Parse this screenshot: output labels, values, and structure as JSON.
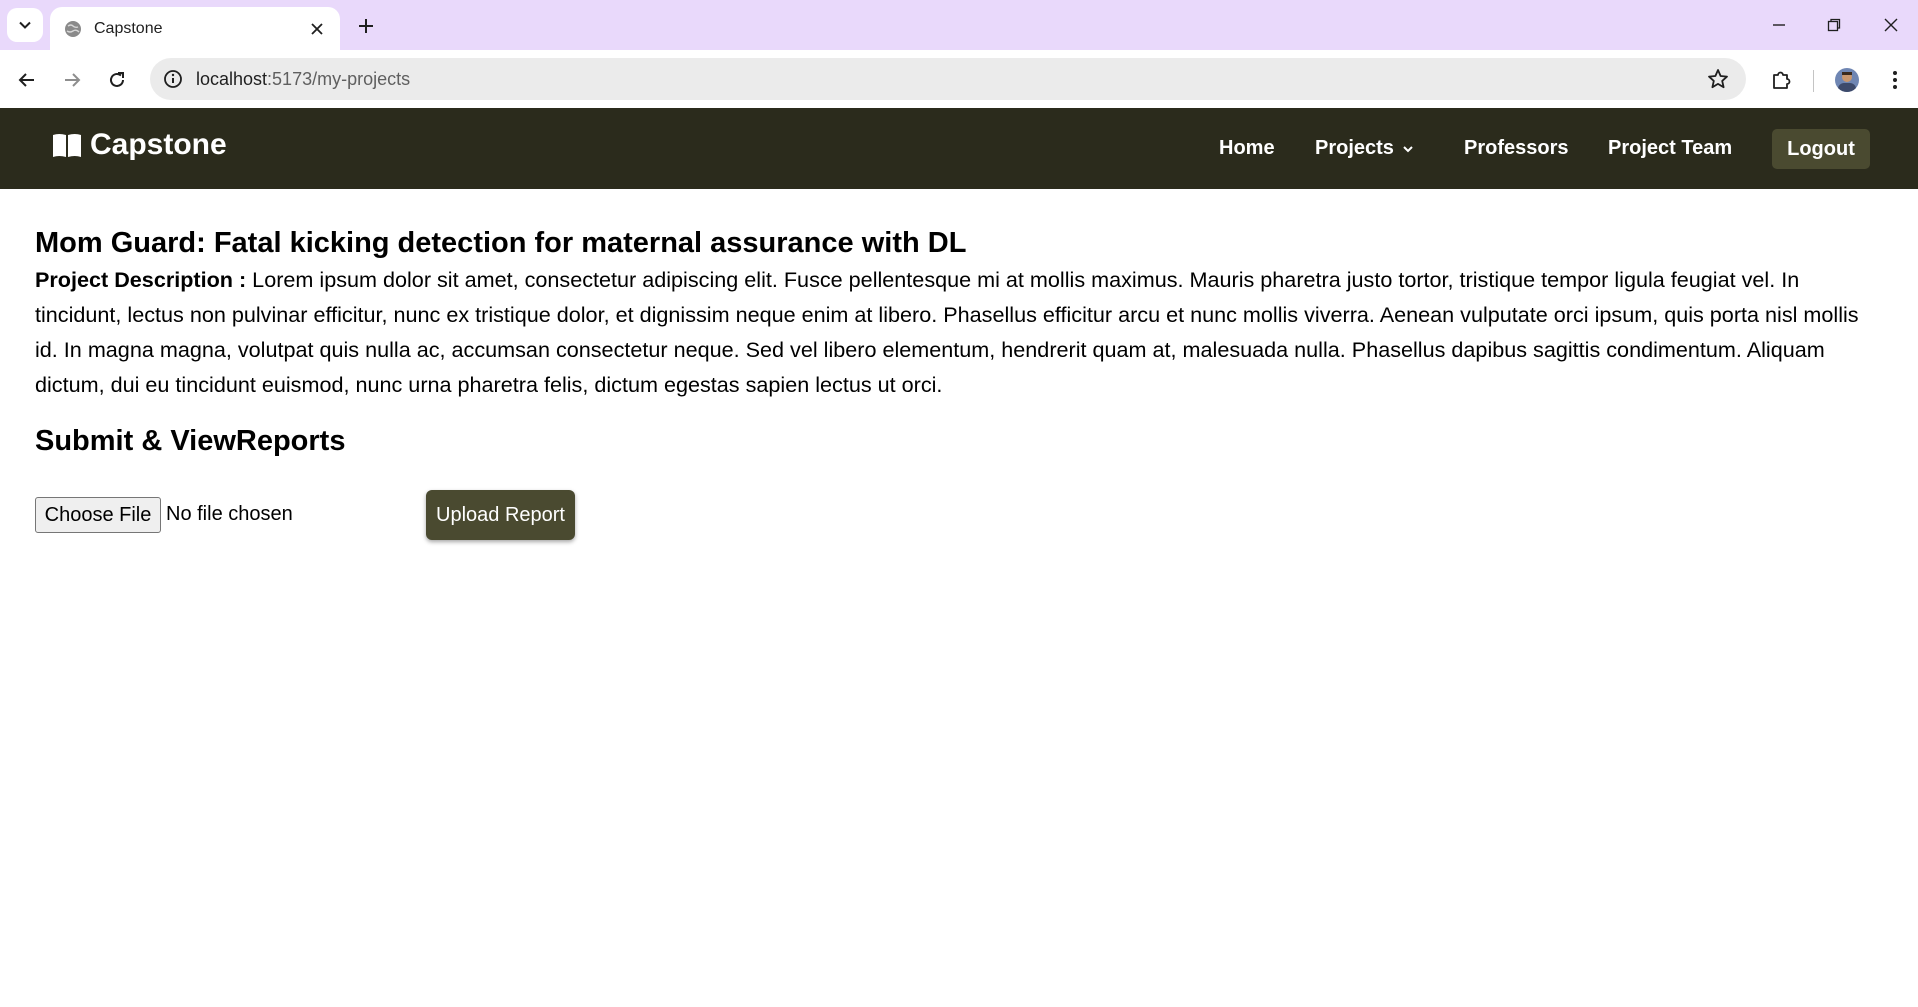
{
  "browser": {
    "tab": {
      "title": "Capstone"
    },
    "address_bar": {
      "host": "localhost",
      "path": ":5173/my-projects"
    }
  },
  "app": {
    "brand": "Capstone",
    "nav": {
      "home": "Home",
      "projects": "Projects",
      "professors": "Professors",
      "project_team": "Project Team",
      "logout": "Logout"
    }
  },
  "project": {
    "title": "Mom Guard: Fatal kicking detection for maternal assurance with DL",
    "description_label": "Project Description :",
    "description": " Lorem ipsum dolor sit amet, consectetur adipiscing elit. Fusce pellentesque mi at mollis maximus. Mauris pharetra justo tortor, tristique tempor ligula feugiat vel. In tincidunt, lectus non pulvinar efficitur, nunc ex tristique dolor, et dignissim neque enim at libero. Phasellus efficitur arcu et nunc mollis viverra. Aenean vulputate orci ipsum, quis porta nisl mollis id. In magna magna, volutpat quis nulla ac, accumsan consectetur neque. Sed vel libero elementum, hendrerit quam at, malesuada nulla. Phasellus dapibus sagittis condimentum. Aliquam dictum, dui eu tincidunt euismod, nunc urna pharetra felis, dictum egestas sapien lectus ut orci."
  },
  "reports": {
    "heading": "Submit & ViewReports",
    "choose_file_label": "Choose File",
    "file_status": "No file chosen",
    "upload_label": "Upload Report"
  },
  "colors": {
    "tabstrip": "#e9d9fb",
    "navbar": "#2b2b1c",
    "accent_button": "#4a4a30"
  },
  "icons": {
    "brand": "book-open-icon",
    "projects_dropdown": "chevron-down-icon"
  }
}
